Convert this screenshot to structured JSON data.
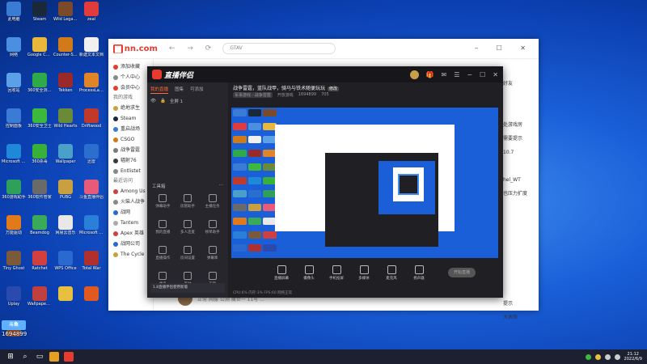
{
  "desktop": {
    "icons": [
      {
        "label": "此电脑",
        "icon": "computer-icon",
        "color": "#3a7bd5"
      },
      {
        "label": "Steam",
        "icon": "steam-icon",
        "color": "#1b2838"
      },
      {
        "label": "Wild Legacy",
        "icon": "wild-legacy-icon",
        "color": "#7a4a2a"
      },
      {
        "label": "zeal",
        "icon": "zeal-icon",
        "color": "#e23b3b"
      },
      {
        "label": "网络",
        "icon": "network-icon",
        "color": "#4a8fe0"
      },
      {
        "label": "Google Chrome",
        "icon": "chrome-icon",
        "color": "#e9b73a"
      },
      {
        "label": "Counter-Strike",
        "icon": "cs-icon",
        "color": "#d07a1a"
      },
      {
        "label": "新建文本文档",
        "icon": "text-doc-icon",
        "color": "#f0f0f0"
      },
      {
        "label": "回收站",
        "icon": "recycle-bin-icon",
        "color": "#5ca0e8"
      },
      {
        "label": "360安全浏览器",
        "icon": "browser-360-icon",
        "color": "#2eaa4a"
      },
      {
        "label": "Tekken",
        "icon": "tekken-icon",
        "color": "#9a2a2a"
      },
      {
        "label": "ProcessLasso",
        "icon": "process-lasso-icon",
        "color": "#e0842a"
      },
      {
        "label": "控制面板",
        "icon": "control-panel-icon",
        "color": "#3a7bd5"
      },
      {
        "label": "360安全卫士",
        "icon": "security-360-icon",
        "color": "#3cb83c"
      },
      {
        "label": "Wild Hearts",
        "icon": "wild-hearts-icon",
        "color": "#6a8a3a"
      },
      {
        "label": "Driftwood",
        "icon": "driftwood-icon",
        "color": "#c0392b"
      },
      {
        "label": "Microsoft Edge",
        "icon": "edge-icon",
        "color": "#1f88d8"
      },
      {
        "label": "360杀毒",
        "icon": "antivirus-360-icon",
        "color": "#38b03a"
      },
      {
        "label": "Wallpaper",
        "icon": "wallpaper-icon",
        "color": "#4aa0c8"
      },
      {
        "label": "迅雷",
        "icon": "thunder-icon",
        "color": "#2a6fd0"
      },
      {
        "label": "360游戏助手",
        "icon": "game-helper-icon",
        "color": "#2ea05a"
      },
      {
        "label": "360软件管家",
        "icon": "software-manager-icon",
        "color": "#6a6a6a"
      },
      {
        "label": "PUBG",
        "icon": "pubg-icon",
        "color": "#c8a040"
      },
      {
        "label": "斗鱼直播伴侣",
        "icon": "douyu-icon",
        "color": "#e85a7a"
      },
      {
        "label": "万能驱动",
        "icon": "driver-icon",
        "color": "#e07a1a"
      },
      {
        "label": "Beamdog",
        "icon": "beamdog-icon",
        "color": "#3aaa5a"
      },
      {
        "label": "网易云音乐",
        "icon": "music-icon",
        "color": "#e8e8e8"
      },
      {
        "label": "Microsoft Store",
        "icon": "store-icon",
        "color": "#2a80d8"
      },
      {
        "label": "Tiny Ghost",
        "icon": "tiny-ghost-icon",
        "color": "#7a5a3a"
      },
      {
        "label": "Ratchet",
        "icon": "ratchet-icon",
        "color": "#d04040"
      },
      {
        "label": "WPS Office",
        "icon": "wps-icon",
        "color": "#2a6ad0"
      },
      {
        "label": "Total War",
        "icon": "total-war-icon",
        "color": "#b03030"
      },
      {
        "label": "Uplay",
        "icon": "uplay-icon",
        "color": "#2a4ab0"
      },
      {
        "label": "Wallpaper Engine",
        "icon": "wallpaper-engine-icon",
        "color": "#c04040"
      },
      {
        "label": "",
        "icon": "game-icon-a",
        "color": "#e8c040"
      },
      {
        "label": "",
        "icon": "game-icon-b",
        "color": "#e05a20"
      },
      {
        "label": "",
        "icon": "game-icon-c",
        "color": "#8a4a2a"
      }
    ]
  },
  "browser": {
    "logo_text": "nn.com",
    "logo_mark": "▆",
    "search_value": "GTAV",
    "side_items": [
      {
        "label": "添加收藏",
        "color": "#e63b2e"
      },
      {
        "label": "个人中心",
        "color": "#888"
      },
      {
        "label": "会员中心",
        "color": "#e63b2e"
      },
      {
        "label": "我的游戏",
        "color": "",
        "head": true
      },
      {
        "label": "绝地求生",
        "color": "#c8a040"
      },
      {
        "label": "Steam",
        "color": "#1b2838"
      },
      {
        "label": "重启战场",
        "color": "#3a7bd5"
      },
      {
        "label": "CSGO",
        "color": "#d07a1a"
      },
      {
        "label": "战争雷霆",
        "color": "#7a7a7a"
      },
      {
        "label": "辐射76",
        "color": "#3a3a3a"
      },
      {
        "label": "Entlistet",
        "color": "#888"
      },
      {
        "label": "最近访问",
        "color": "",
        "head": true
      },
      {
        "label": "Among Us",
        "color": "#d04040"
      },
      {
        "label": "火柴人战争",
        "color": "#888"
      },
      {
        "label": "战网",
        "color": "#2a6ad0"
      },
      {
        "label": "Tantem",
        "color": "#aaa"
      },
      {
        "label": "Apex 英雄",
        "color": "#d04040"
      },
      {
        "label": "战网公司",
        "color": "#2a6ad0"
      },
      {
        "label": "The Cycle",
        "color": "#c8a040"
      }
    ],
    "right_items": [
      "好友",
      "",
      "",
      "处游戏房",
      "需要提示",
      "10.7",
      "",
      "hel_WT",
      "也压力扩度",
      "",
      "",
      "",
      "",
      "",
      "",
      "",
      "提示",
      "大表哥"
    ],
    "bottom_text": "正常  网服  公测  魔世一  11号  ...",
    "win_controls": "⎯ ☐ ✕"
  },
  "app": {
    "title": "直播伴侣",
    "title_suffix": "",
    "tabs": [
      {
        "label": "我的直播",
        "active": true
      },
      {
        "label": "图集",
        "active": false
      },
      {
        "label": "可添加",
        "active": false
      }
    ],
    "scene_label": "全屏 1",
    "stream_title": "战争雷霆，蓝队战甲，骑马与铁术随便玩玩",
    "stream_tag": "修改",
    "meta": [
      "军事游戏 · 战争雷霆",
      "开放游戏",
      "1694899",
      "705"
    ],
    "tools_label": "工具箱",
    "tools": [
      {
        "label": "弹幕助手"
      },
      {
        "label": "房管助手"
      },
      {
        "label": "主播任务"
      },
      {
        "label": "我的直播"
      },
      {
        "label": "多人连麦"
      },
      {
        "label": "榜单助手"
      },
      {
        "label": "直播操作"
      },
      {
        "label": "房间设置"
      },
      {
        "label": "弹幕库"
      },
      {
        "label": "更多"
      },
      {
        "label": "互动"
      },
      {
        "label": "下载"
      }
    ],
    "promo": "1.8直播伴侣使用新版",
    "bottom_buttons": [
      {
        "label": "直播屏幕"
      },
      {
        "label": "摄像头"
      },
      {
        "label": "手机投屏"
      },
      {
        "label": "多媒体"
      },
      {
        "label": "麦克风"
      },
      {
        "label": "扬声器"
      }
    ],
    "start_button": "开始直播",
    "status": "CPU:6%  内存:3%  FPS:60  网络正常"
  },
  "watermark": {
    "logo": "斗鱼",
    "number": "1694899"
  },
  "taskbar": {
    "time": "21:12",
    "date": "2022/6/9"
  },
  "colors": {
    "accent": "#e63b2e",
    "desktop_blue": "#1a5fd8",
    "app_bg": "#1f1f24"
  }
}
